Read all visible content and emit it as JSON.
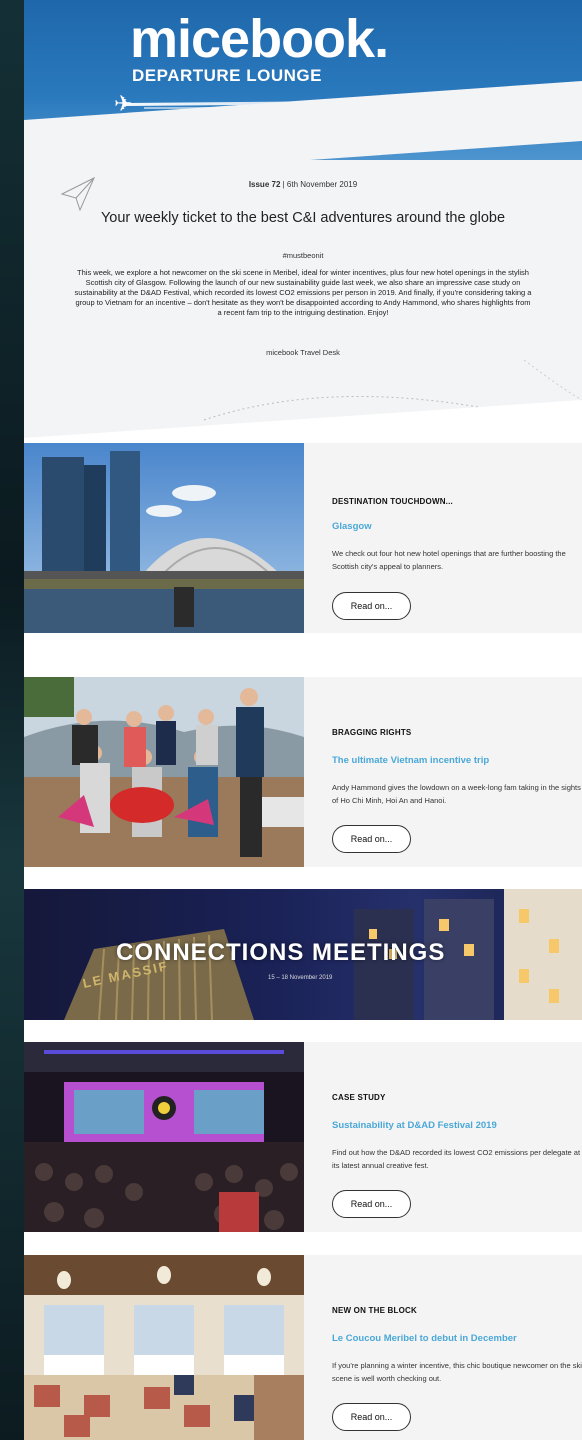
{
  "header": {
    "logo": "micebook.",
    "logo_sub": "DEPARTURE LOUNGE"
  },
  "intro": {
    "issue_label": "Issue 72",
    "issue_sep": " | ",
    "issue_date": "6th November 2019",
    "tagline": "Your weekly ticket to the best C&I adventures around the globe",
    "hashtag": "#mustbeonit",
    "body": "This week, we explore a hot newcomer on the ski scene in Meribel, ideal for winter incentives, plus four new hotel openings in the stylish Scottish city of Glasgow. Following the launch of our new sustainability guide last week, we also share an impressive case study on sustainability at the D&AD Festival, which recorded its lowest CO2 emissions per person in 2019. And finally, if you're considering taking a group to Vietnam for an incentive – don't hesitate as they won't be disappointed according to Andy Hammond, who shares highlights from a recent fam trip to the intriguing destination. Enjoy!",
    "signoff": "micebook Travel Desk"
  },
  "articles": [
    {
      "kicker": "DESTINATION TOUCHDOWN...",
      "headline": "Glasgow",
      "description": "We check out four hot new hotel openings that are further boosting the Scottish city's appeal to planners.",
      "button": "Read on..."
    },
    {
      "kicker": "BRAGGING RIGHTS",
      "headline": "The ultimate Vietnam incentive trip",
      "description": "Andy Hammond gives the lowdown on a week-long fam taking in the sights of Ho Chi Minh, Hoi An and Hanoi.",
      "button": "Read on..."
    },
    {
      "kicker": "CASE STUDY",
      "headline": "Sustainability at D&AD Festival 2019",
      "description": "Find out how the D&AD recorded its lowest CO2 emissions per delegate at its latest annual creative fest.",
      "button": "Read on..."
    },
    {
      "kicker": "NEW ON THE BLOCK",
      "headline": "Le Coucou Meribel to debut in December",
      "description": "If you're planning a winter incentive, this chic boutique newcomer on the ski scene is well worth checking out.",
      "button": "Read on..."
    }
  ],
  "banner": {
    "title": "CONNECTIONS MEETINGS",
    "dates": "15 – 18 November 2019",
    "sign": "LE MASSIF"
  },
  "colors": {
    "header_blue": "#1f67ab",
    "headline_blue": "#4aa8d8",
    "card_bg": "#f4f4f4"
  }
}
